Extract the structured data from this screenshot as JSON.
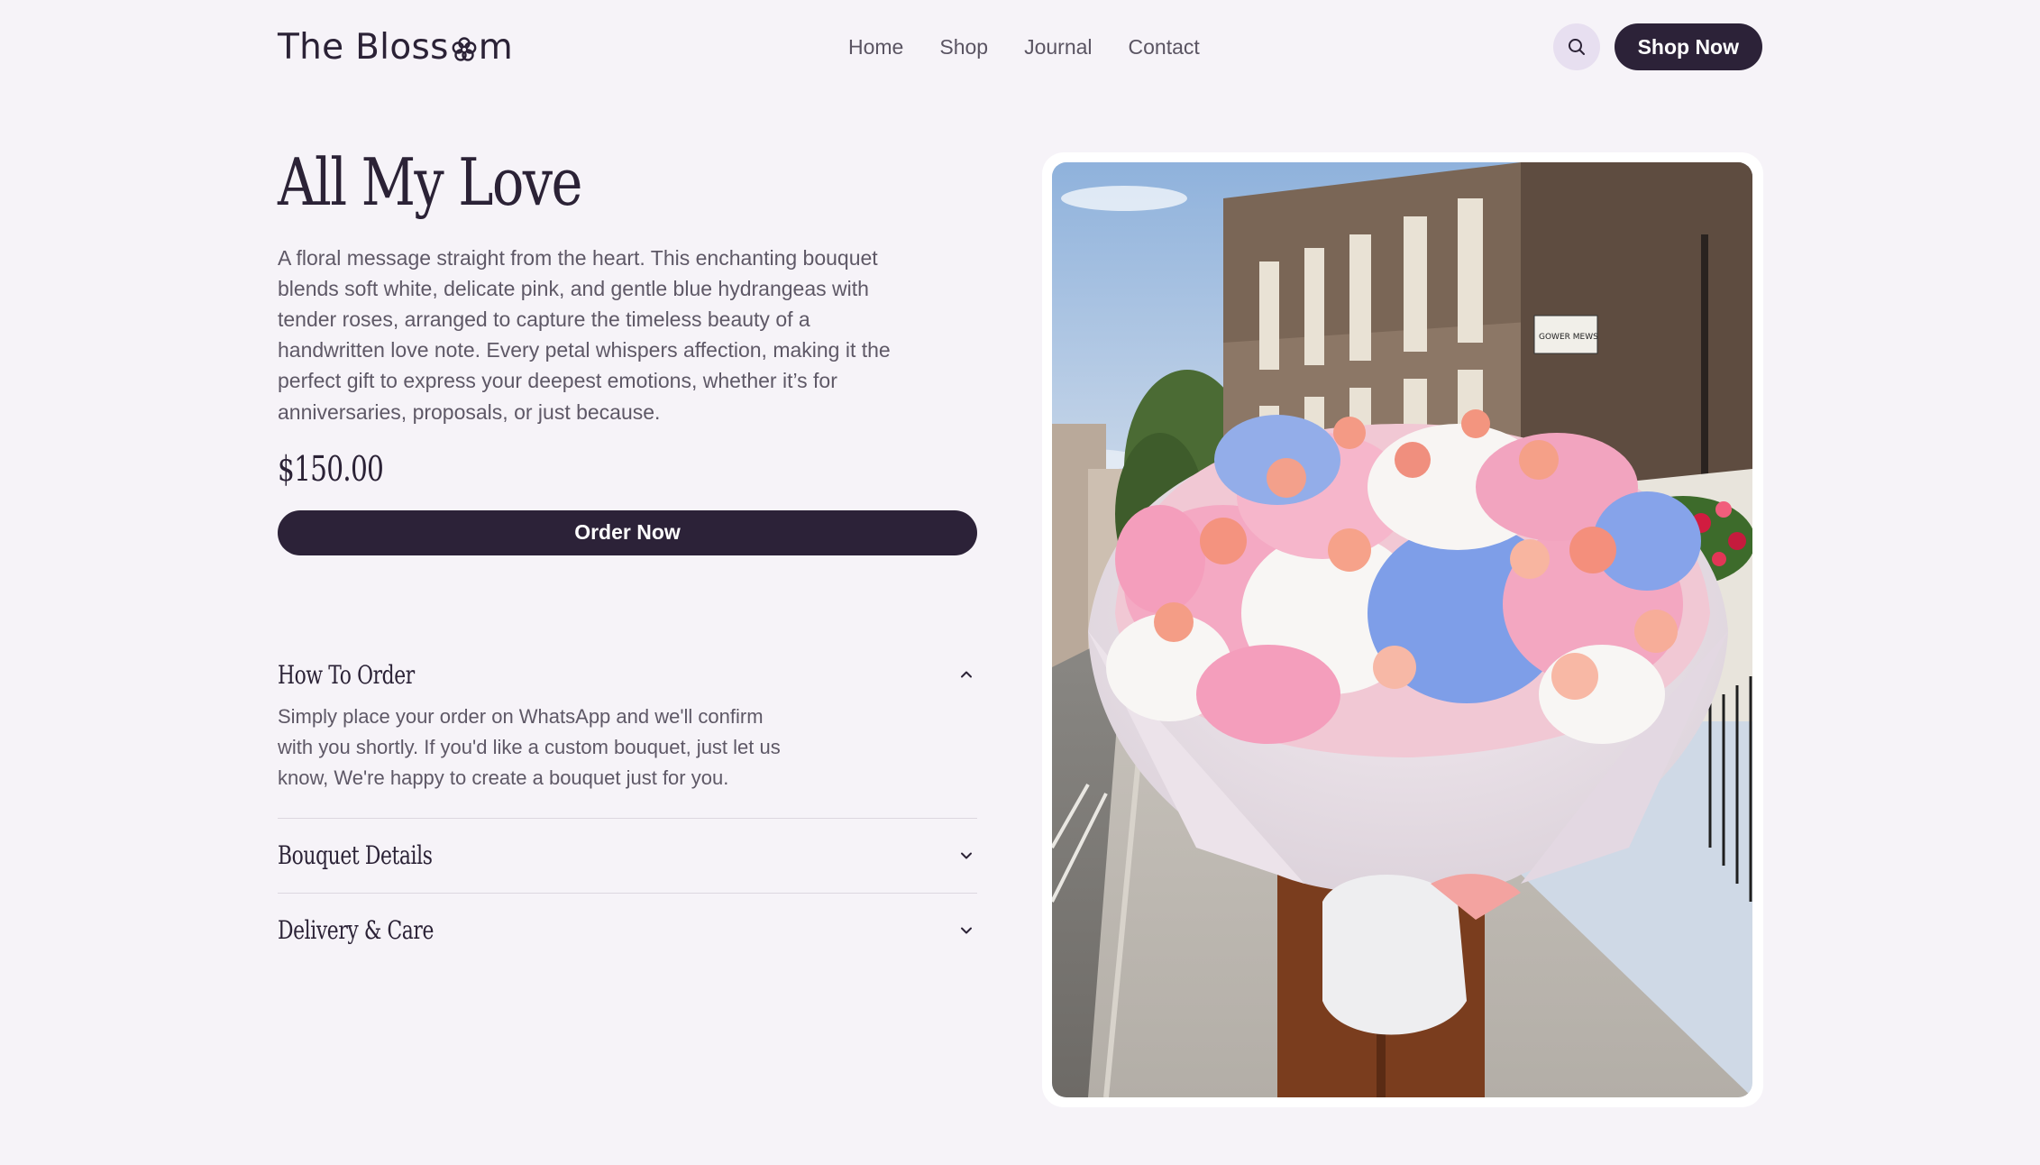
{
  "header": {
    "logo_before": "The Bloss",
    "logo_after": "m",
    "nav": [
      "Home",
      "Shop",
      "Journal",
      "Contact"
    ],
    "shop_button": "Shop Now",
    "search_icon": "search-icon"
  },
  "product": {
    "title": "All My Love",
    "description": "A floral message straight from the heart. This enchanting bouquet blends soft white, delicate pink, and gentle blue hydrangeas with tender roses, arranged to capture the timeless beauty of a handwritten love note. Every petal whispers affection, making it the perfect gift to express your deepest emotions, whether it’s for anniversaries, proposals, or just because.",
    "price": "$150.00",
    "order_button": "Order Now"
  },
  "accordion": [
    {
      "title": "How To Order",
      "open": true,
      "body": "Simply place your order on WhatsApp and we'll confirm with you shortly. If you'd like a custom bouquet, just let us know, We're happy to create a bouquet just for you."
    },
    {
      "title": "Bouquet Details",
      "open": false
    },
    {
      "title": "Delivery & Care",
      "open": false
    }
  ],
  "image": {
    "street_sign": "GOWER MEWS"
  },
  "colors": {
    "background": "#f6f3f8",
    "primary": "#2c2238",
    "search_bg": "#e7dff0",
    "text_muted": "#5e5866"
  }
}
